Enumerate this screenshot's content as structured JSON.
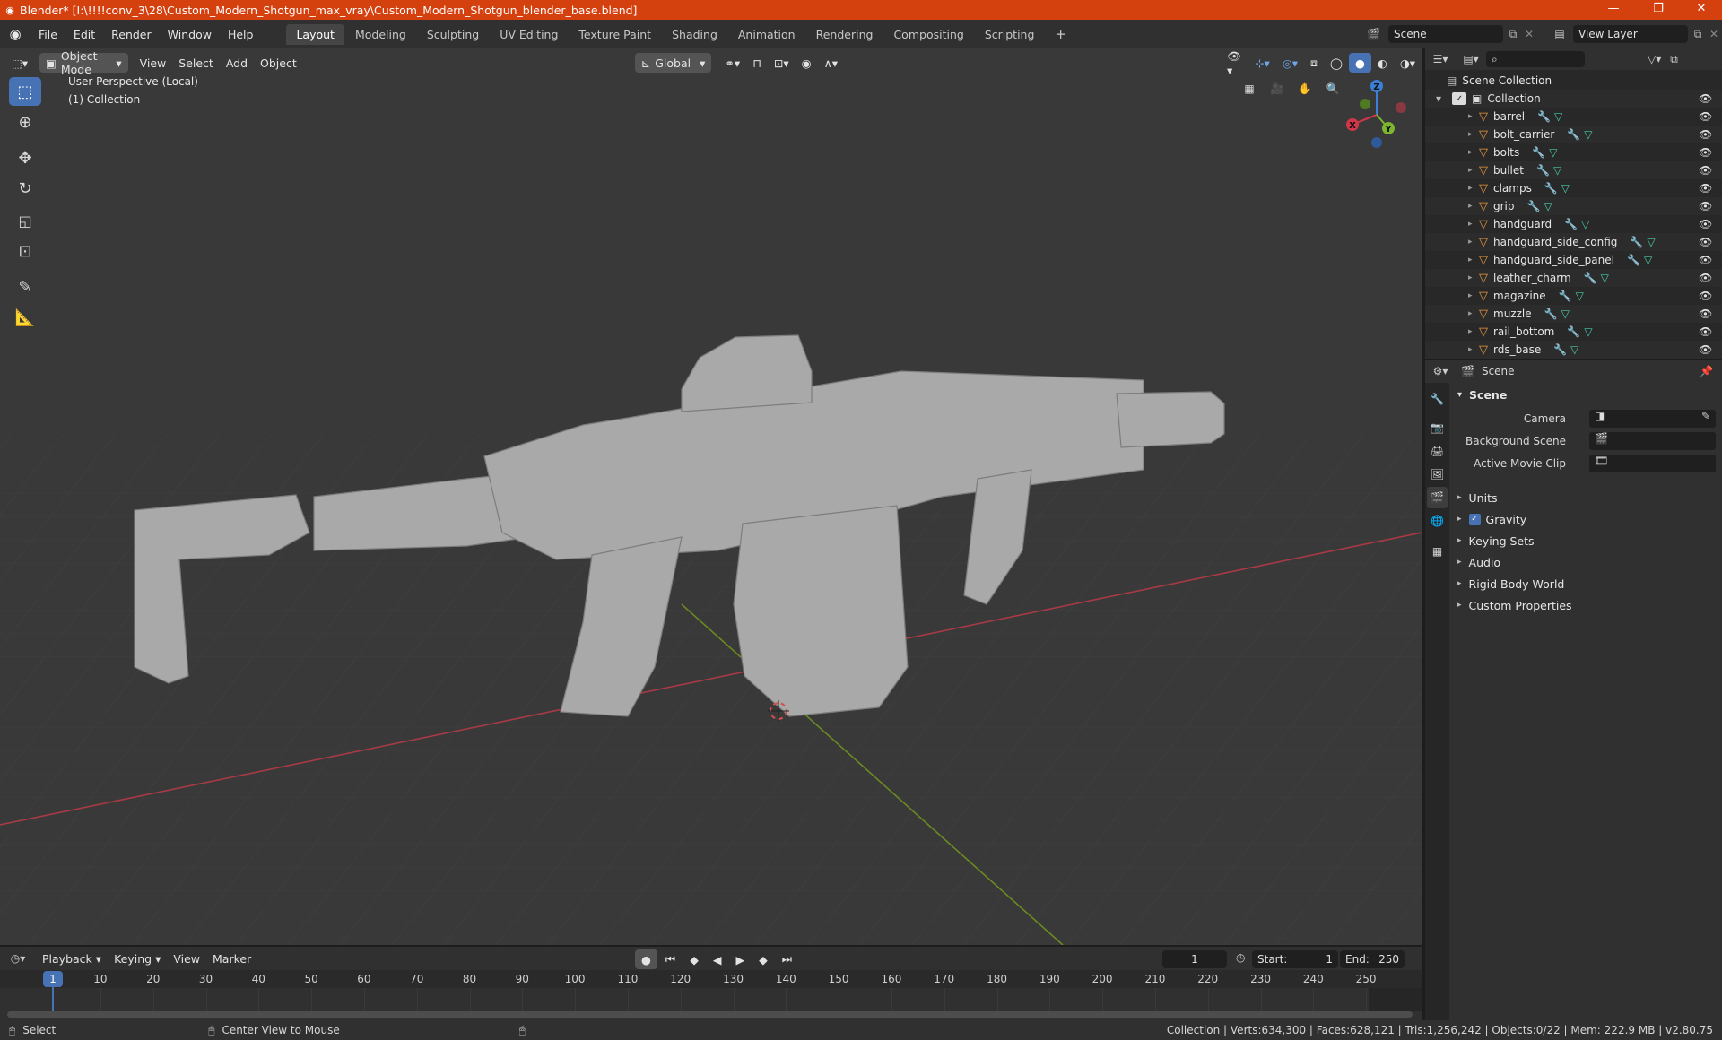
{
  "title_bar": {
    "text": "Blender* [I:\\!!!!conv_3\\28\\Custom_Modern_Shotgun_max_vray\\Custom_Modern_Shotgun_blender_base.blend]",
    "minimize": "—",
    "restore": "❐",
    "close": "✕"
  },
  "menu": [
    "File",
    "Edit",
    "Render",
    "Window",
    "Help"
  ],
  "workspaces": [
    "Layout",
    "Modeling",
    "Sculpting",
    "UV Editing",
    "Texture Paint",
    "Shading",
    "Animation",
    "Rendering",
    "Compositing",
    "Scripting"
  ],
  "active_workspace": "Layout",
  "add_workspace": "+",
  "scene_name": "Scene",
  "view_layer": "View Layer",
  "viewport": {
    "mode": "Object Mode",
    "menus": [
      "View",
      "Select",
      "Add",
      "Object"
    ],
    "transform_orientation": "Global",
    "overlay_line1": "User Perspective (Local)",
    "overlay_line2": "(1) Collection",
    "gizmo": {
      "x": "X",
      "y": "Y",
      "z": "Z"
    },
    "background_color": "#393939",
    "x_axis_color": "#a83a45",
    "y_axis_color": "#6b8a22"
  },
  "outliner": {
    "root": "Scene Collection",
    "collection": "Collection",
    "objects": [
      "barrel",
      "bolt_carrier",
      "bolts",
      "bullet",
      "clamps",
      "grip",
      "handguard",
      "handguard_side_config",
      "handguard_side_panel",
      "leather_charm",
      "magazine",
      "muzzle",
      "rail_bottom",
      "rds_base"
    ]
  },
  "properties": {
    "header": "Scene",
    "panel": "Scene",
    "fields": [
      {
        "label": "Camera",
        "value": ""
      },
      {
        "label": "Background Scene",
        "value": ""
      },
      {
        "label": "Active Movie Clip",
        "value": ""
      }
    ],
    "sections": [
      "Units",
      "Gravity",
      "Keying Sets",
      "Audio",
      "Rigid Body World",
      "Custom Properties"
    ],
    "gravity_enabled": true
  },
  "timeline": {
    "menus": [
      "Playback",
      "Keying",
      "View",
      "Marker"
    ],
    "current_frame": "1",
    "start_label": "Start:",
    "start": "1",
    "end_label": "End:",
    "end": "250",
    "ticks": [
      "10",
      "20",
      "30",
      "40",
      "50",
      "60",
      "70",
      "80",
      "90",
      "100",
      "110",
      "120",
      "130",
      "140",
      "150",
      "160",
      "170",
      "180",
      "190",
      "200",
      "210",
      "220",
      "230",
      "240",
      "250"
    ]
  },
  "status_bar": {
    "select": "Select",
    "center": "Center View to Mouse",
    "stats": "Collection | Verts:634,300 | Faces:628,121 | Tris:1,256,242 | Objects:0/22 | Mem: 222.9 MB | v2.80.75"
  },
  "colors": {
    "accent": "#4772b3",
    "title_bar": "#d5400f",
    "object_icon": "#e8973e",
    "modifier_icon": "#6ea8e8",
    "mesh_icon": "#49c9a8"
  }
}
